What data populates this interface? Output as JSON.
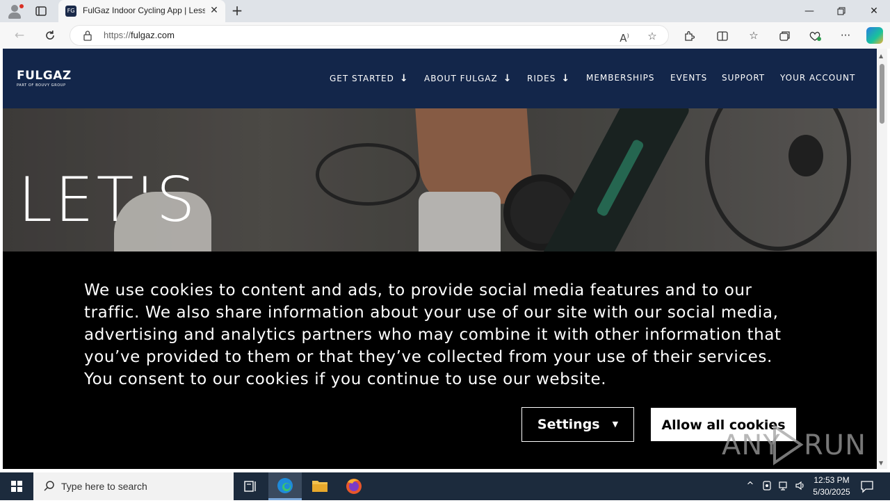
{
  "browser": {
    "tab_title": "FulGaz Indoor Cycling App | Less",
    "url_scheme": "https://",
    "url_host": "fulgaz.com",
    "favicon_text": "FG"
  },
  "site": {
    "logo_main": "FULGAZ",
    "logo_sub": "PART OF BOUVY GROUP",
    "nav": [
      {
        "label": "GET STARTED",
        "has_dropdown": true
      },
      {
        "label": "ABOUT FULGAZ",
        "has_dropdown": true
      },
      {
        "label": "RIDES",
        "has_dropdown": true
      },
      {
        "label": "MEMBERSHIPS",
        "has_dropdown": false
      },
      {
        "label": "EVENTS",
        "has_dropdown": false
      },
      {
        "label": "SUPPORT",
        "has_dropdown": false
      },
      {
        "label": "YOUR ACCOUNT",
        "has_dropdown": false
      }
    ],
    "hero_title": "LET'S",
    "nav_arrow": "↓"
  },
  "cookie_banner": {
    "text": "We use cookies to content and ads, to provide social media features and to our traffic. We also share information about your use of our site with our social media, advertising and analytics partners who may combine it with other information that you’ve provided to them or that they’ve collected from your use of their services. You consent to our cookies if you continue to use our website.",
    "settings_label": "Settings",
    "allow_label": "Allow all cookies"
  },
  "watermark": {
    "left": "ANY",
    "right": "RUN"
  },
  "taskbar": {
    "search_placeholder": "Type here to search",
    "time": "12:53 PM",
    "date": "5/30/2025"
  },
  "colors": {
    "site_header": "#13264a",
    "banner_bg": "#000000",
    "taskbar": "#1c2b3d"
  }
}
